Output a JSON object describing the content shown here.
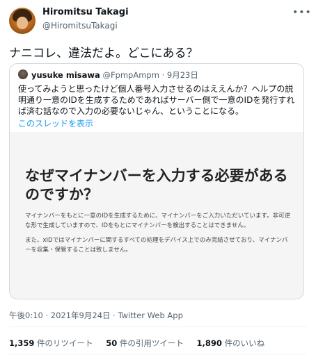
{
  "tweet": {
    "author_name": "Hiromitsu Takagi",
    "author_handle": "@HiromitsuTakagi",
    "text": "ナニコレ、違法だよ。どこにある？",
    "more_icon": "more-dots-icon",
    "timestamp": "午後0:10 · 2021年9月24日",
    "via_separator": " · ",
    "source_app": "Twitter Web App"
  },
  "quoted": {
    "author_name": "yusuke misawa",
    "author_handle": "@FpmpAmpm",
    "date": "· 9月23日",
    "text": "使ってみようと思ったけど個人番号入力させるのはええんか？ヘルプの説明通り一意のIDを生成するためであればサーバー側で一意のIDを発行すれば済む話なので入力の必要ないじゃん、ということになる。",
    "show_thread": "このスレッドを表示",
    "image": {
      "heading": "なぜマイナンバーを入力する必要があるのですか？",
      "paragraph1": "マイナンバーをもとに一意のIDを生成するために、マイナンバーをご入力いただいています。非可逆な形で生成していますので、IDをもとにマイナンバーを検出することはできません。",
      "paragraph2": "また、xIDではマイナンバーに関するすべての処理をデバイス上でのみ完結させており、マイナンバーを収集・保管することは致しません。"
    }
  },
  "stats": {
    "retweets_count": "1,359",
    "retweets_label": " 件のリツイート",
    "quotes_count": "50",
    "quotes_label": " 件の引用ツイート",
    "likes_count": "1,890",
    "likes_label": " 件のいいね"
  }
}
